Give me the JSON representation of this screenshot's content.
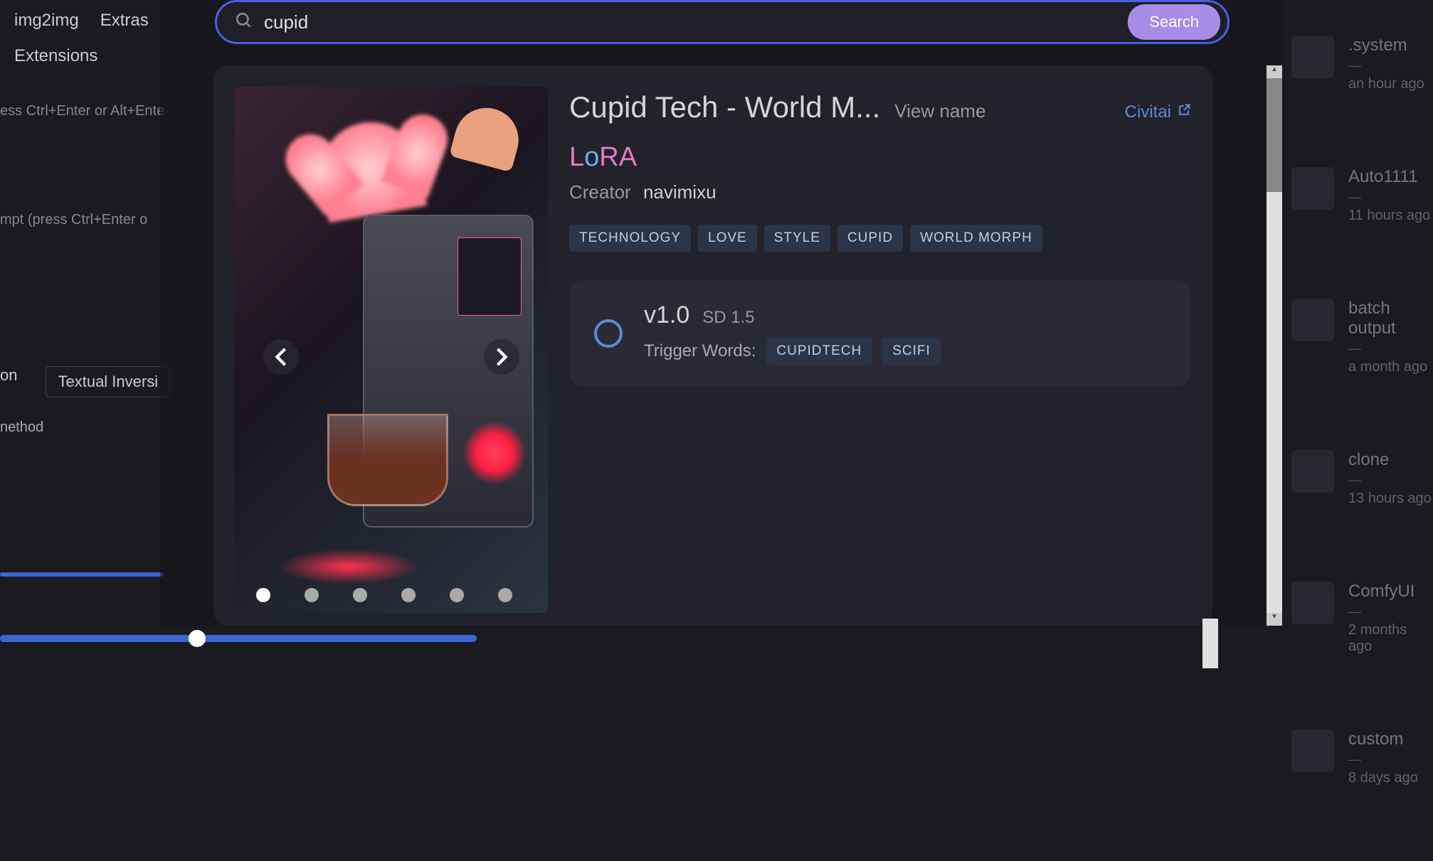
{
  "bg_tabs": {
    "img2img": "img2img",
    "extras": "Extras",
    "extensions": "Extensions"
  },
  "bg_hints": {
    "hint1": "ess Ctrl+Enter or Alt+Ente",
    "hint2": "mpt (press Ctrl+Enter o"
  },
  "bg_sub_tabs": {
    "on": "on",
    "textual": "Textual Inversi"
  },
  "bg_method": "nethod",
  "search": {
    "value": "cupid",
    "button": "Search"
  },
  "model": {
    "title": "Cupid Tech - World M...",
    "view_name": "View name",
    "civitai": "Civitai",
    "type": "LoRA",
    "creator_label": "Creator",
    "creator_name": "navimixu",
    "tags": [
      "TECHNOLOGY",
      "LOVE",
      "STYLE",
      "CUPID",
      "WORLD MORPH"
    ]
  },
  "version": {
    "name": "v1.0",
    "base": "SD 1.5",
    "trigger_label": "Trigger Words:",
    "triggers": [
      "CUPIDTECH",
      "SCIFI"
    ]
  },
  "sidebar": [
    {
      "title": ".system",
      "dash": "—",
      "time": "an hour ago"
    },
    {
      "title": "Auto1111",
      "dash": "—",
      "time": "11 hours ago"
    },
    {
      "title": "batch output",
      "dash": "—",
      "time": "a month ago"
    },
    {
      "title": "clone",
      "dash": "—",
      "time": "13 hours ago"
    },
    {
      "title": "ComfyUI",
      "dash": "—",
      "time": "2 months ago"
    },
    {
      "title": "custom",
      "dash": "—",
      "time": "8 days ago"
    }
  ]
}
